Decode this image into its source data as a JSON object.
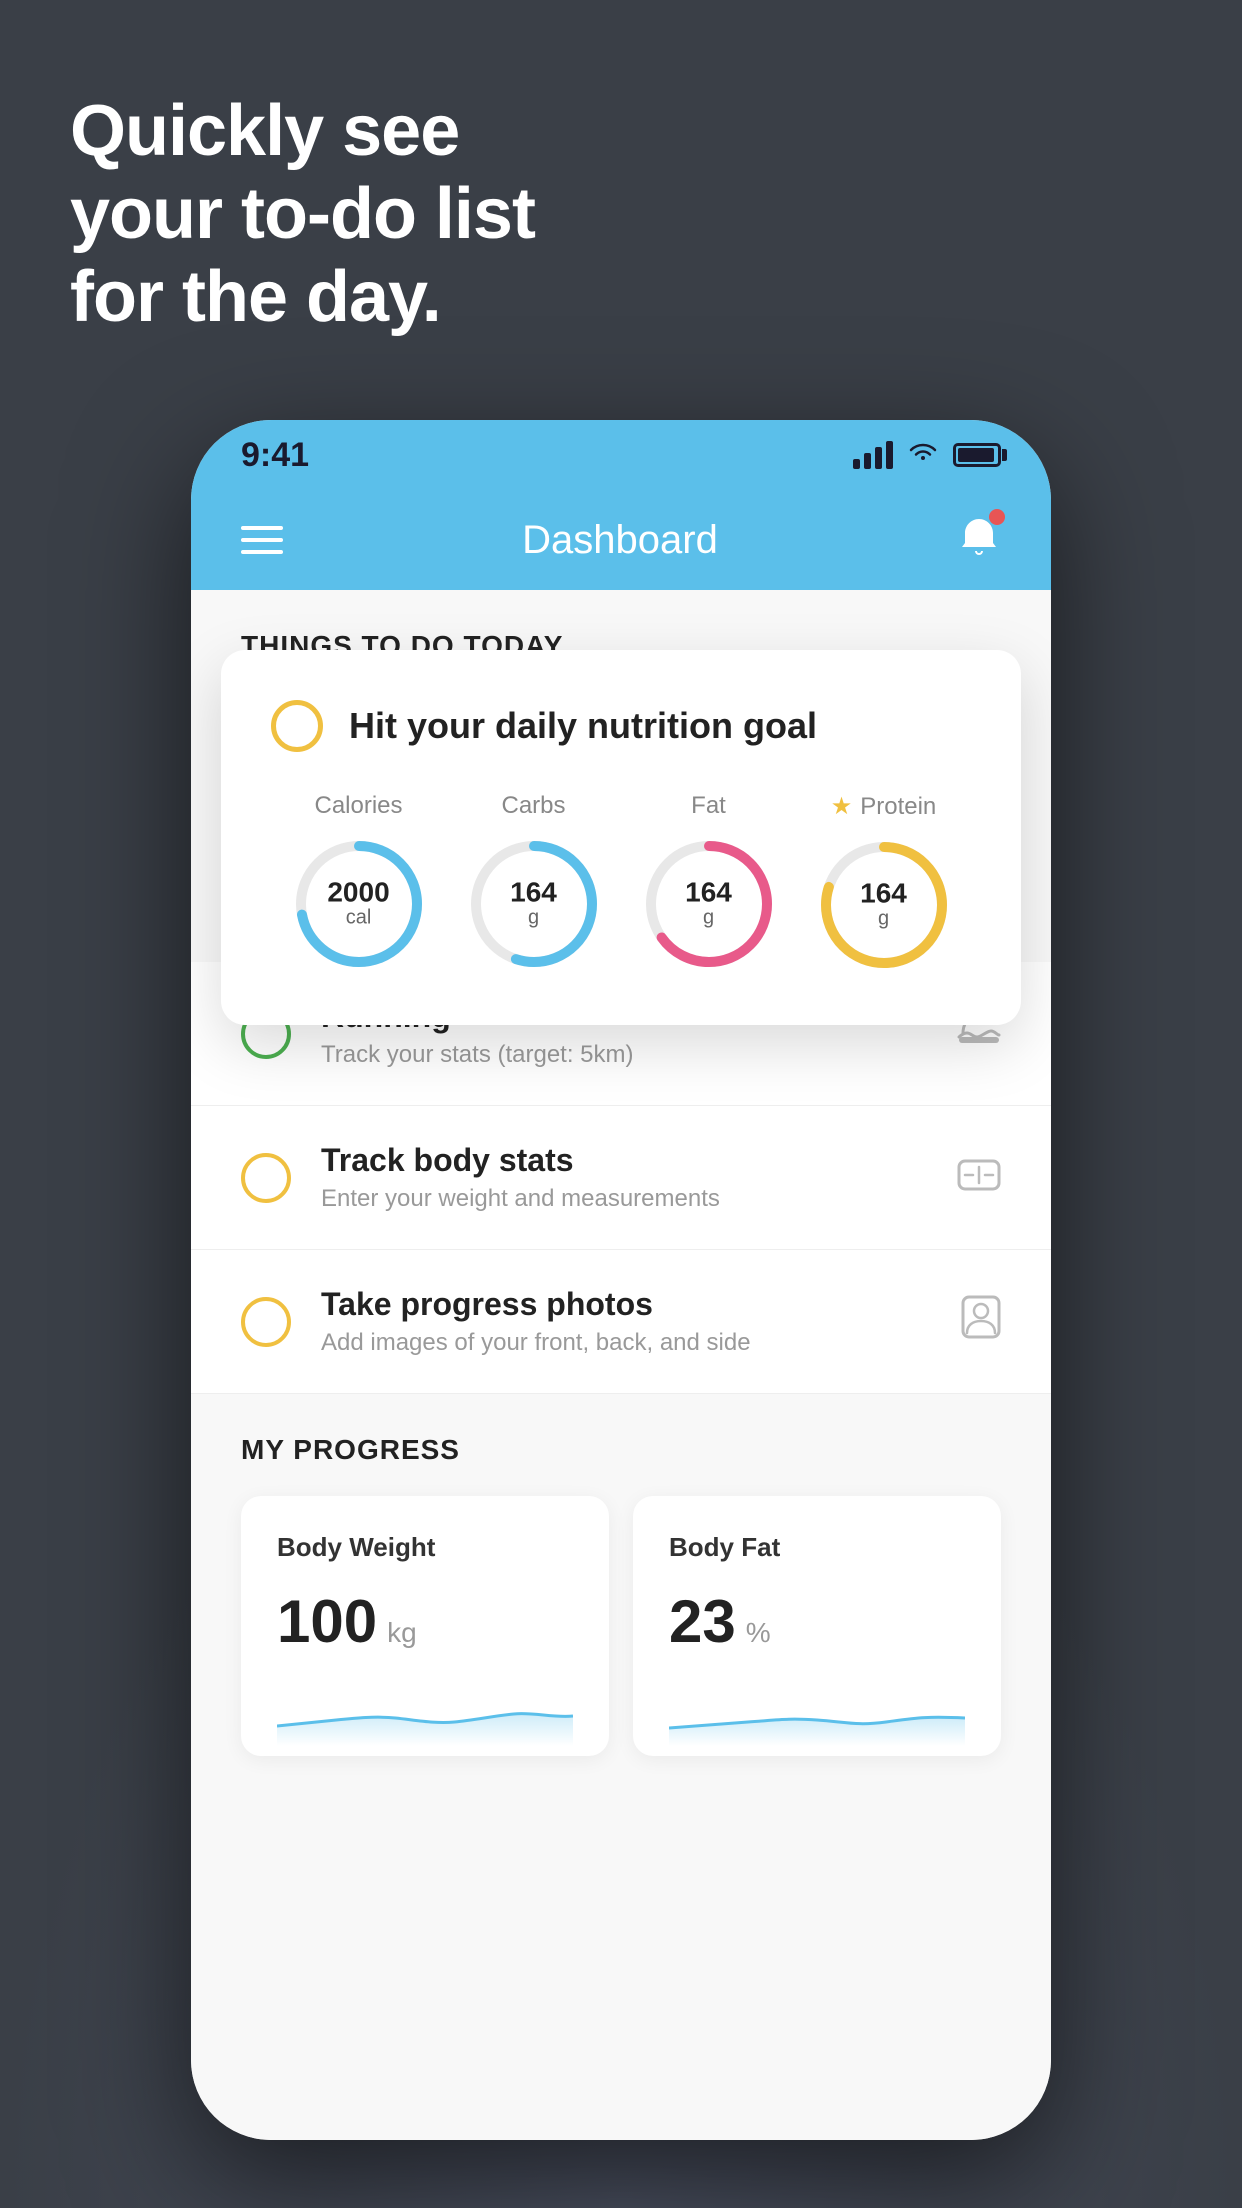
{
  "background_color": "#3a3f47",
  "hero": {
    "line1": "Quickly see",
    "line2": "your to-do list",
    "line3": "for the day."
  },
  "phone": {
    "status_bar": {
      "time": "9:41",
      "signal_bars": 4,
      "wifi": true,
      "battery": true
    },
    "nav": {
      "title": "Dashboard",
      "menu_label": "menu",
      "bell_label": "notifications"
    },
    "section_header": "THINGS TO DO TODAY",
    "floating_card": {
      "check_color": "#f0c040",
      "title": "Hit your daily nutrition goal",
      "nutrition": [
        {
          "label": "Calories",
          "value": "2000",
          "unit": "cal",
          "color": "#5bbfea",
          "track_color": "#e8e8e8",
          "progress": 0.72,
          "starred": false
        },
        {
          "label": "Carbs",
          "value": "164",
          "unit": "g",
          "color": "#5bbfea",
          "track_color": "#e8e8e8",
          "progress": 0.55,
          "starred": false
        },
        {
          "label": "Fat",
          "value": "164",
          "unit": "g",
          "color": "#e85a8a",
          "track_color": "#e8e8e8",
          "progress": 0.65,
          "starred": false
        },
        {
          "label": "Protein",
          "value": "164",
          "unit": "g",
          "color": "#f0c040",
          "track_color": "#e8e8e8",
          "progress": 0.8,
          "starred": true
        }
      ]
    },
    "todo_items": [
      {
        "id": "running",
        "title": "Running",
        "subtitle": "Track your stats (target: 5km)",
        "circle_color": "#4caf50",
        "icon": "shoe"
      },
      {
        "id": "body-stats",
        "title": "Track body stats",
        "subtitle": "Enter your weight and measurements",
        "circle_color": "#f0c040",
        "icon": "scale"
      },
      {
        "id": "progress-photos",
        "title": "Take progress photos",
        "subtitle": "Add images of your front, back, and side",
        "circle_color": "#f0c040",
        "icon": "person"
      }
    ],
    "progress_section": {
      "title": "MY PROGRESS",
      "cards": [
        {
          "id": "body-weight",
          "title": "Body Weight",
          "value": "100",
          "unit": "kg"
        },
        {
          "id": "body-fat",
          "title": "Body Fat",
          "value": "23",
          "unit": "%"
        }
      ]
    }
  }
}
